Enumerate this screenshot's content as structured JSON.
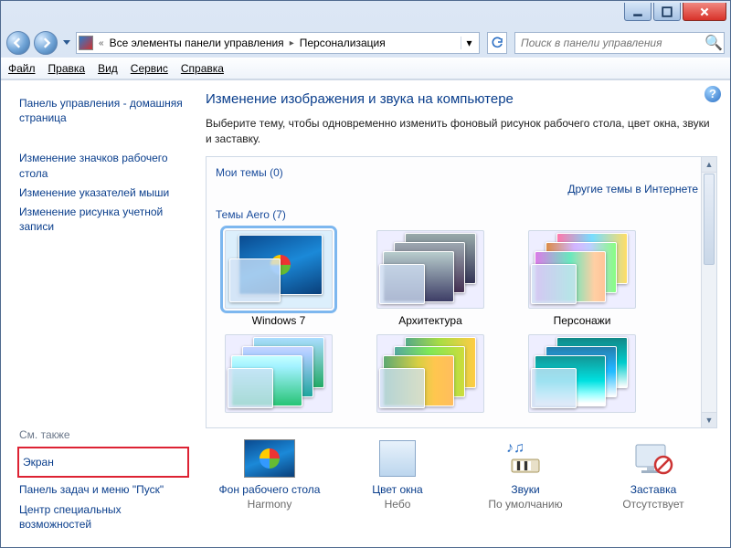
{
  "breadcrumb": {
    "root_sep": "«",
    "item1": "Все элементы панели управления",
    "item2": "Персонализация"
  },
  "search": {
    "placeholder": "Поиск в панели управления"
  },
  "menu": {
    "file": "Файл",
    "edit": "Правка",
    "view": "Вид",
    "tools": "Сервис",
    "help": "Справка"
  },
  "sidebar": {
    "home": "Панель управления - домашняя страница",
    "l1": "Изменение значков рабочего стола",
    "l2": "Изменение указателей мыши",
    "l3": "Изменение рисунка учетной записи",
    "see_also_head": "См. также",
    "s1": "Экран",
    "s2": "Панель задач и меню \"Пуск\"",
    "s3": "Центр специальных возможностей"
  },
  "content": {
    "title": "Изменение изображения и звука на компьютере",
    "subtitle": "Выберите тему, чтобы одновременно изменить фоновый рисунок рабочего стола, цвет окна, звуки и заставку.",
    "my_themes_label": "Мои темы (0)",
    "online_link": "Другие темы в Интернете",
    "aero_label": "Темы Aero (7)",
    "themes_row1": [
      {
        "label": "Windows 7"
      },
      {
        "label": "Архитектура"
      },
      {
        "label": "Персонажи"
      }
    ],
    "bottom": [
      {
        "label": "Фон рабочего стола",
        "sub": "Harmony"
      },
      {
        "label": "Цвет окна",
        "sub": "Небо"
      },
      {
        "label": "Звуки",
        "sub": "По умолчанию"
      },
      {
        "label": "Заставка",
        "sub": "Отсутствует"
      }
    ]
  }
}
